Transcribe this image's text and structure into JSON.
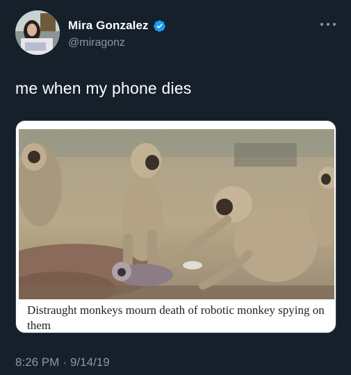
{
  "author": {
    "display_name": "Mira Gonzalez",
    "handle": "@miragonz",
    "verified": true
  },
  "tweet": {
    "text": "me when my phone dies",
    "media": {
      "caption": "Distraught monkeys mourn death of robotic monkey spying on them"
    }
  },
  "meta": {
    "time": "8:26 PM",
    "separator": "·",
    "date": "9/14/19"
  },
  "icons": {
    "verified": "verified-badge-icon",
    "more": "more-options-icon"
  },
  "colors": {
    "background": "#15202b",
    "text": "#ffffff",
    "secondary_text": "#8b98a5",
    "verified_blue": "#1d9bf0"
  }
}
